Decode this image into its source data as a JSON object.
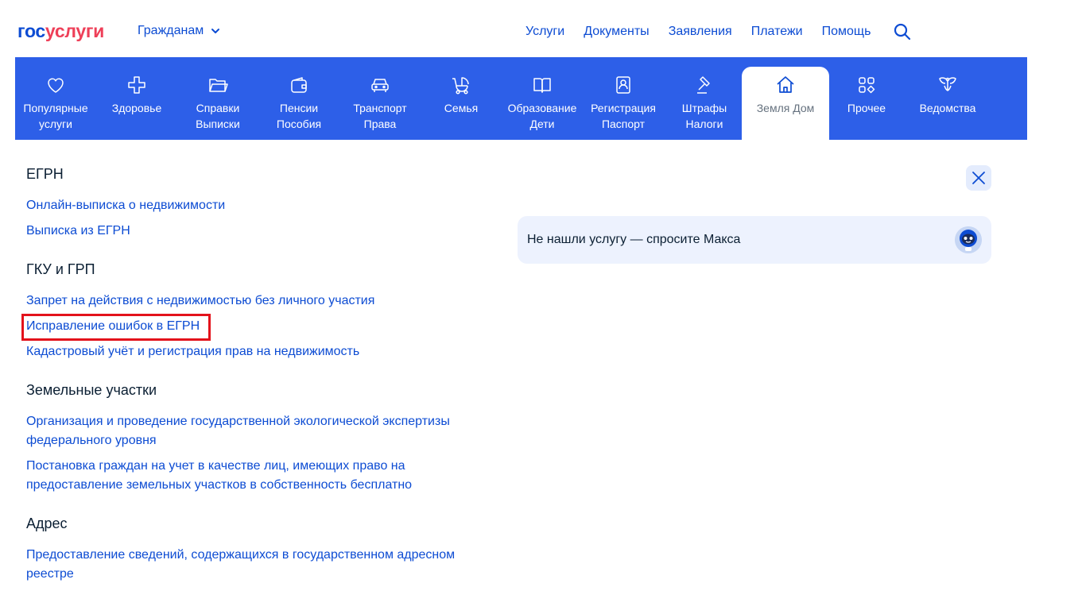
{
  "header": {
    "logo_part1": "гос",
    "logo_part2": "услуги",
    "audience": "Гражданам",
    "nav": [
      "Услуги",
      "Документы",
      "Заявления",
      "Платежи",
      "Помощь"
    ]
  },
  "categories": [
    {
      "line1": "Популярные",
      "line2": "услуги",
      "icon": "heart-icon"
    },
    {
      "line1": "Здоровье",
      "line2": "",
      "icon": "health-cross-icon"
    },
    {
      "line1": "Справки",
      "line2": "Выписки",
      "icon": "folder-icon"
    },
    {
      "line1": "Пенсии",
      "line2": "Пособия",
      "icon": "wallet-icon"
    },
    {
      "line1": "Транспорт",
      "line2": "Права",
      "icon": "car-icon"
    },
    {
      "line1": "Семья",
      "line2": "",
      "icon": "stroller-icon"
    },
    {
      "line1": "Образование",
      "line2": "Дети",
      "icon": "book-icon"
    },
    {
      "line1": "Регистрация",
      "line2": "Паспорт",
      "icon": "passport-icon"
    },
    {
      "line1": "Штрафы",
      "line2": "Налоги",
      "icon": "gavel-icon"
    },
    {
      "line1": "Земля Дом",
      "line2": "",
      "icon": "house-icon"
    },
    {
      "line1": "Прочее",
      "line2": "",
      "icon": "grid-icon"
    },
    {
      "line1": "Ведомства",
      "line2": "",
      "icon": "eagle-icon"
    }
  ],
  "panel": {
    "egrn_title": "ЕГРН",
    "egrn_links": [
      "Онлайн-выписка о недвижимости",
      "Выписка из ЕГРН"
    ],
    "gku_title": "ГКУ и ГРП",
    "gku_links": [
      "Запрет на действия с недвижимостью без личного участия",
      "Исправление ошибок в ЕГРН",
      "Кадастровый учёт и регистрация прав на недвижимость"
    ],
    "land_title": "Земельные участки",
    "land_links": [
      "Организация и проведение государственной экологической экспертизы федерального уровня",
      "Постановка граждан на учет в качестве лиц, имеющих право на предоставление земельных участков в собственность бесплатно"
    ],
    "address_title": "Адрес",
    "address_links": [
      "Предоставление сведений, содержащихся в государственном адресном реестре"
    ]
  },
  "assistant": {
    "prompt": "Не нашли услугу — спросите Макса"
  },
  "colors": {
    "brand_blue": "#0d4cd3",
    "brand_red": "#ee3f58",
    "category_bar": "#2d5fe8",
    "highlight": "#e3121b"
  }
}
